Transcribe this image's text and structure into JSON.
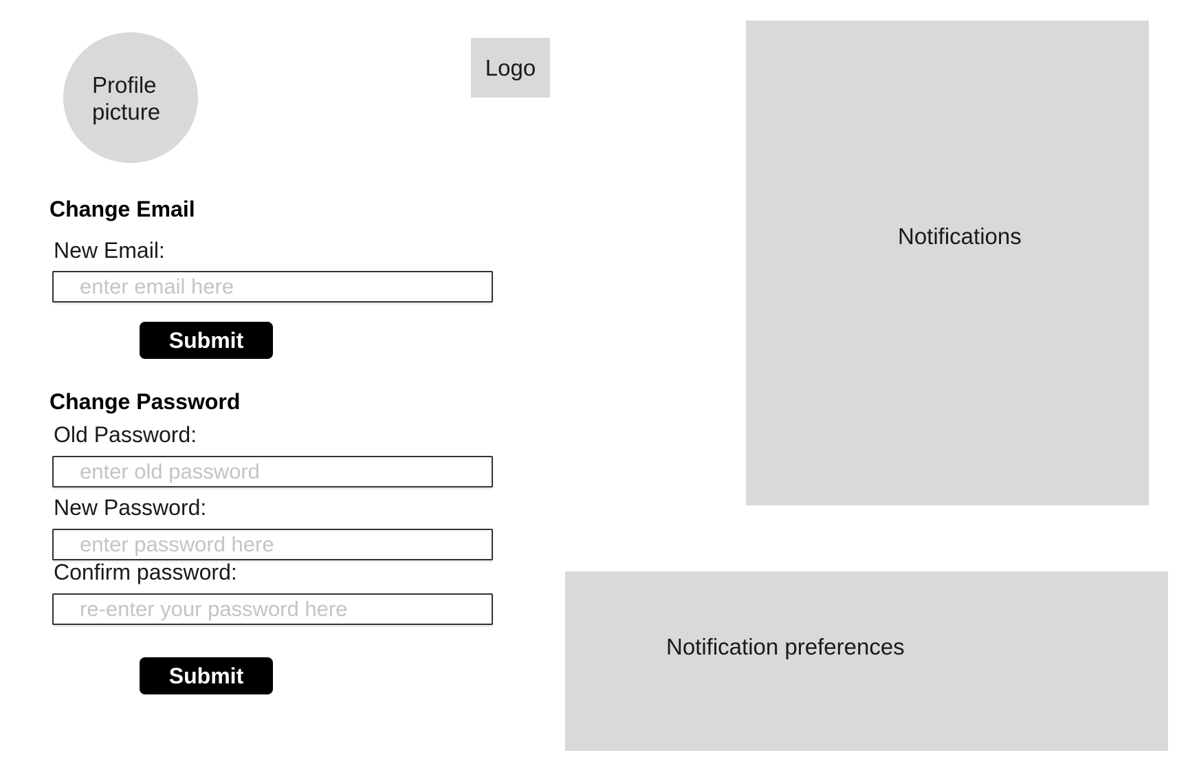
{
  "profile": {
    "picture_label": "Profile picture"
  },
  "logo": {
    "label": "Logo"
  },
  "change_email": {
    "title": "Change Email",
    "new_email_label": "New Email:",
    "new_email_placeholder": "enter email here",
    "new_email_value": "",
    "submit_label": "Submit"
  },
  "change_password": {
    "title": "Change Password",
    "old_password_label": "Old Password:",
    "old_password_placeholder": "enter old password",
    "new_password_label": "New Password:",
    "new_password_placeholder": "enter password here",
    "confirm_password_label": "Confirm password:",
    "confirm_password_placeholder": "re-enter your password here",
    "submit_label": "Submit"
  },
  "notifications": {
    "label": "Notifications"
  },
  "notification_preferences": {
    "label": "Notification preferences"
  },
  "colors": {
    "placeholder_box": "#d9d9d9",
    "button_bg": "#000000",
    "button_text": "#ffffff",
    "placeholder_text": "#c4c4c4"
  }
}
